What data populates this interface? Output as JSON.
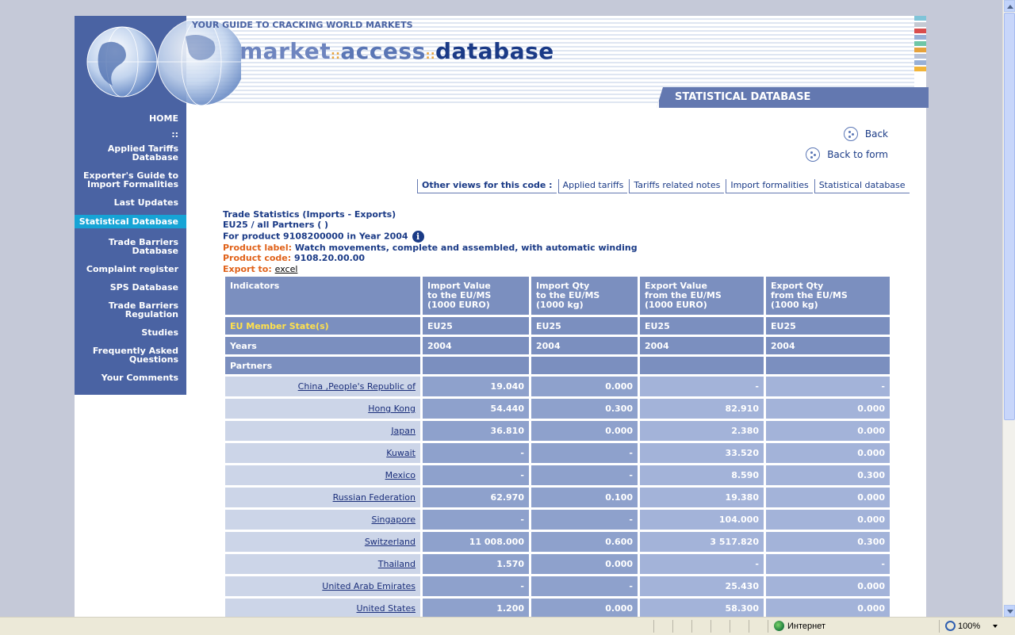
{
  "header": {
    "tagline": "YOUR GUIDE TO CRACKING WORLD MARKETS",
    "logo": {
      "part1": "market",
      "part2": "access",
      "part3": "database"
    },
    "section_title": "STATISTICAL DATABASE",
    "color_bars": [
      "#7fc4d8",
      "#c5cad3",
      "#d94d4d",
      "#98b0d7",
      "#6fc6a6",
      "#e6a23c",
      "#b9c3d9",
      "#98b0d7",
      "#f2b53a"
    ]
  },
  "sidebar": {
    "items": [
      {
        "label": "HOME"
      },
      {
        "label": "::"
      },
      {
        "label": "Applied Tariffs Database"
      },
      {
        "label": "Exporter's Guide to Import Formalities"
      },
      {
        "label": "Last Updates"
      },
      {
        "label": "Statistical Database",
        "active": true
      },
      {
        "label": "Trade Barriers Database"
      },
      {
        "label": "Complaint register"
      },
      {
        "label": "SPS Database"
      },
      {
        "label": "Trade Barriers Regulation"
      },
      {
        "label": "Studies"
      },
      {
        "label": "Frequently Asked Questions"
      },
      {
        "label": "Your Comments"
      }
    ]
  },
  "nav": {
    "back": "Back",
    "back_to_form": "Back to form"
  },
  "views": {
    "label": "Other views for this code :",
    "items": [
      "Applied tariffs",
      "Tariffs related notes",
      "Import formalities",
      "Statistical database"
    ]
  },
  "info": {
    "title": "Trade Statistics (Imports - Exports)",
    "scope": "EU25 / all Partners ( )",
    "product_year": "For product 9108200000 in Year 2004",
    "product_label_key": "Product label:",
    "product_label_value": "Watch movements, complete and assembled, with automatic winding",
    "product_code_key": "Product code:",
    "product_code_value": "9108.20.00.00",
    "export_key": "Export to:",
    "export_link": "excel"
  },
  "table": {
    "headers": [
      "Indicators",
      "Import Value\nto the EU/MS\n(1000 EURO)",
      "Import Qty\nto the EU/MS\n(1000 kg)",
      "Export Value\nfrom the EU/MS\n(1000 EURO)",
      "Export Qty\nfrom the EU/MS\n(1000 kg)"
    ],
    "member_state_row": [
      "EU Member State(s)",
      "EU25",
      "EU25",
      "EU25",
      "EU25"
    ],
    "years_row": [
      "Years",
      "2004",
      "2004",
      "2004",
      "2004"
    ],
    "partners_row": [
      "Partners",
      "",
      "",
      "",
      ""
    ],
    "rows": [
      {
        "partner": "China ,People's Republic of",
        "values": [
          "19.040",
          "0.000",
          "-",
          "-"
        ]
      },
      {
        "partner": "Hong Kong",
        "values": [
          "54.440",
          "0.300",
          "82.910",
          "0.000"
        ]
      },
      {
        "partner": "Japan",
        "values": [
          "36.810",
          "0.000",
          "2.380",
          "0.000"
        ]
      },
      {
        "partner": "Kuwait",
        "values": [
          "-",
          "-",
          "33.520",
          "0.000"
        ]
      },
      {
        "partner": "Mexico",
        "values": [
          "-",
          "-",
          "8.590",
          "0.300"
        ]
      },
      {
        "partner": "Russian Federation",
        "values": [
          "62.970",
          "0.100",
          "19.380",
          "0.000"
        ]
      },
      {
        "partner": "Singapore",
        "values": [
          "-",
          "-",
          "104.000",
          "0.000"
        ]
      },
      {
        "partner": "Switzerland",
        "values": [
          "11 008.000",
          "0.600",
          "3 517.820",
          "0.300"
        ]
      },
      {
        "partner": "Thailand",
        "values": [
          "1.570",
          "0.000",
          "-",
          "-"
        ]
      },
      {
        "partner": "United Arab Emirates",
        "values": [
          "-",
          "-",
          "25.430",
          "0.000"
        ]
      },
      {
        "partner": "United States",
        "values": [
          "1.200",
          "0.000",
          "58.300",
          "0.000"
        ]
      }
    ]
  },
  "statusbar": {
    "zone": "Интернет",
    "zoom": "100%"
  }
}
